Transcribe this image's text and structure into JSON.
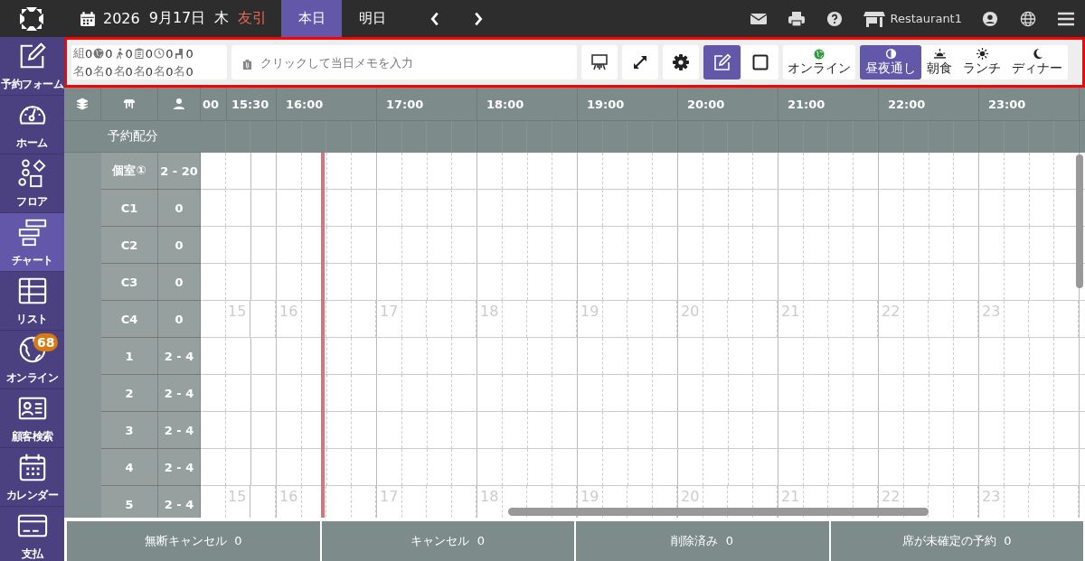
{
  "topbar": {
    "year": "2026",
    "date": "9月17日",
    "weekday": "木",
    "rokuyo": "友引",
    "day_tabs": [
      {
        "label": "本日",
        "selected": true
      },
      {
        "label": "明日",
        "selected": false
      }
    ],
    "store_name": "Restaurant1"
  },
  "sidebar": {
    "items": [
      {
        "kind": "form",
        "label": "予約フォーム",
        "selected": false
      },
      {
        "kind": "home",
        "label": "ホーム",
        "selected": false
      },
      {
        "kind": "floor",
        "label": "フロア",
        "selected": false
      },
      {
        "kind": "chart",
        "label": "チャート",
        "selected": true
      },
      {
        "kind": "list",
        "label": "リスト",
        "selected": false
      },
      {
        "kind": "online",
        "label": "オンライン",
        "selected": false,
        "badge": "68"
      },
      {
        "kind": "customer",
        "label": "顧客検索",
        "selected": false
      },
      {
        "kind": "calendar",
        "label": "カレンダー",
        "selected": false
      },
      {
        "kind": "payment",
        "label": "支払",
        "selected": false
      }
    ]
  },
  "toolbar": {
    "highlighted": true,
    "stats": [
      {
        "kind": "groups",
        "label": "組",
        "value": "0",
        "people_label": "名",
        "people": "0"
      },
      {
        "kind": "online",
        "value": "0",
        "people_label": "名",
        "people": "0"
      },
      {
        "kind": "walkin",
        "value": "0",
        "people_label": "名",
        "people": "0"
      },
      {
        "kind": "reserved",
        "value": "0",
        "people_label": "名",
        "people": "0"
      },
      {
        "kind": "waiting",
        "value": "0",
        "people_label": "名",
        "people": "0"
      },
      {
        "kind": "seated",
        "value": "0",
        "people_label": "名",
        "people": "0"
      }
    ],
    "memo": {
      "placeholder": "クリックして当日メモを入力"
    },
    "tools": [
      {
        "kind": "display"
      },
      {
        "kind": "fullscreen"
      },
      {
        "kind": "settings"
      }
    ],
    "mode_toggle": [
      {
        "kind": "edit",
        "selected": true
      },
      {
        "kind": "select",
        "selected": false
      }
    ],
    "online_button": {
      "label": "オンライン"
    },
    "meal_filters": [
      {
        "kind": "allday",
        "label": "昼夜通し",
        "selected": true
      },
      {
        "kind": "breakfast",
        "label": "朝食",
        "selected": false
      },
      {
        "kind": "lunch",
        "label": "ランチ",
        "selected": false
      },
      {
        "kind": "dinner",
        "label": "ディナー",
        "selected": false
      }
    ]
  },
  "chart": {
    "allocation_label": "予約配分",
    "hours": [
      {
        "labels": [
          "00",
          "15:30"
        ]
      },
      {
        "labels": [
          "16:00"
        ]
      },
      {
        "labels": [
          "17:00"
        ]
      },
      {
        "labels": [
          "18:00"
        ]
      },
      {
        "labels": [
          "19:00"
        ]
      },
      {
        "labels": [
          "20:00"
        ]
      },
      {
        "labels": [
          "21:00"
        ]
      },
      {
        "labels": [
          "22:00"
        ]
      },
      {
        "labels": [
          "23:00"
        ]
      }
    ],
    "tables": [
      {
        "name": "個室①",
        "capacity": "2 - 20"
      },
      {
        "name": "C1",
        "capacity": "0"
      },
      {
        "name": "C2",
        "capacity": "0"
      },
      {
        "name": "C3",
        "capacity": "0"
      },
      {
        "name": "C4",
        "capacity": "0",
        "hour_marks": [
          "15",
          "16",
          "17",
          "18",
          "19",
          "20",
          "21",
          "22",
          "23"
        ]
      },
      {
        "name": "1",
        "capacity": "2 - 4"
      },
      {
        "name": "2",
        "capacity": "2 - 4"
      },
      {
        "name": "3",
        "capacity": "2 - 4"
      },
      {
        "name": "4",
        "capacity": "2 - 4"
      },
      {
        "name": "5",
        "capacity": "2 - 4",
        "hour_marks": [
          "15",
          "16",
          "17",
          "18",
          "19",
          "20",
          "21",
          "22",
          "23"
        ]
      }
    ]
  },
  "footer": [
    {
      "label": "無断キャンセル",
      "count": "0"
    },
    {
      "label": "キャンセル",
      "count": "0"
    },
    {
      "label": "削除済み",
      "count": "0"
    },
    {
      "label": "席が未確定の予約",
      "count": "0"
    }
  ]
}
